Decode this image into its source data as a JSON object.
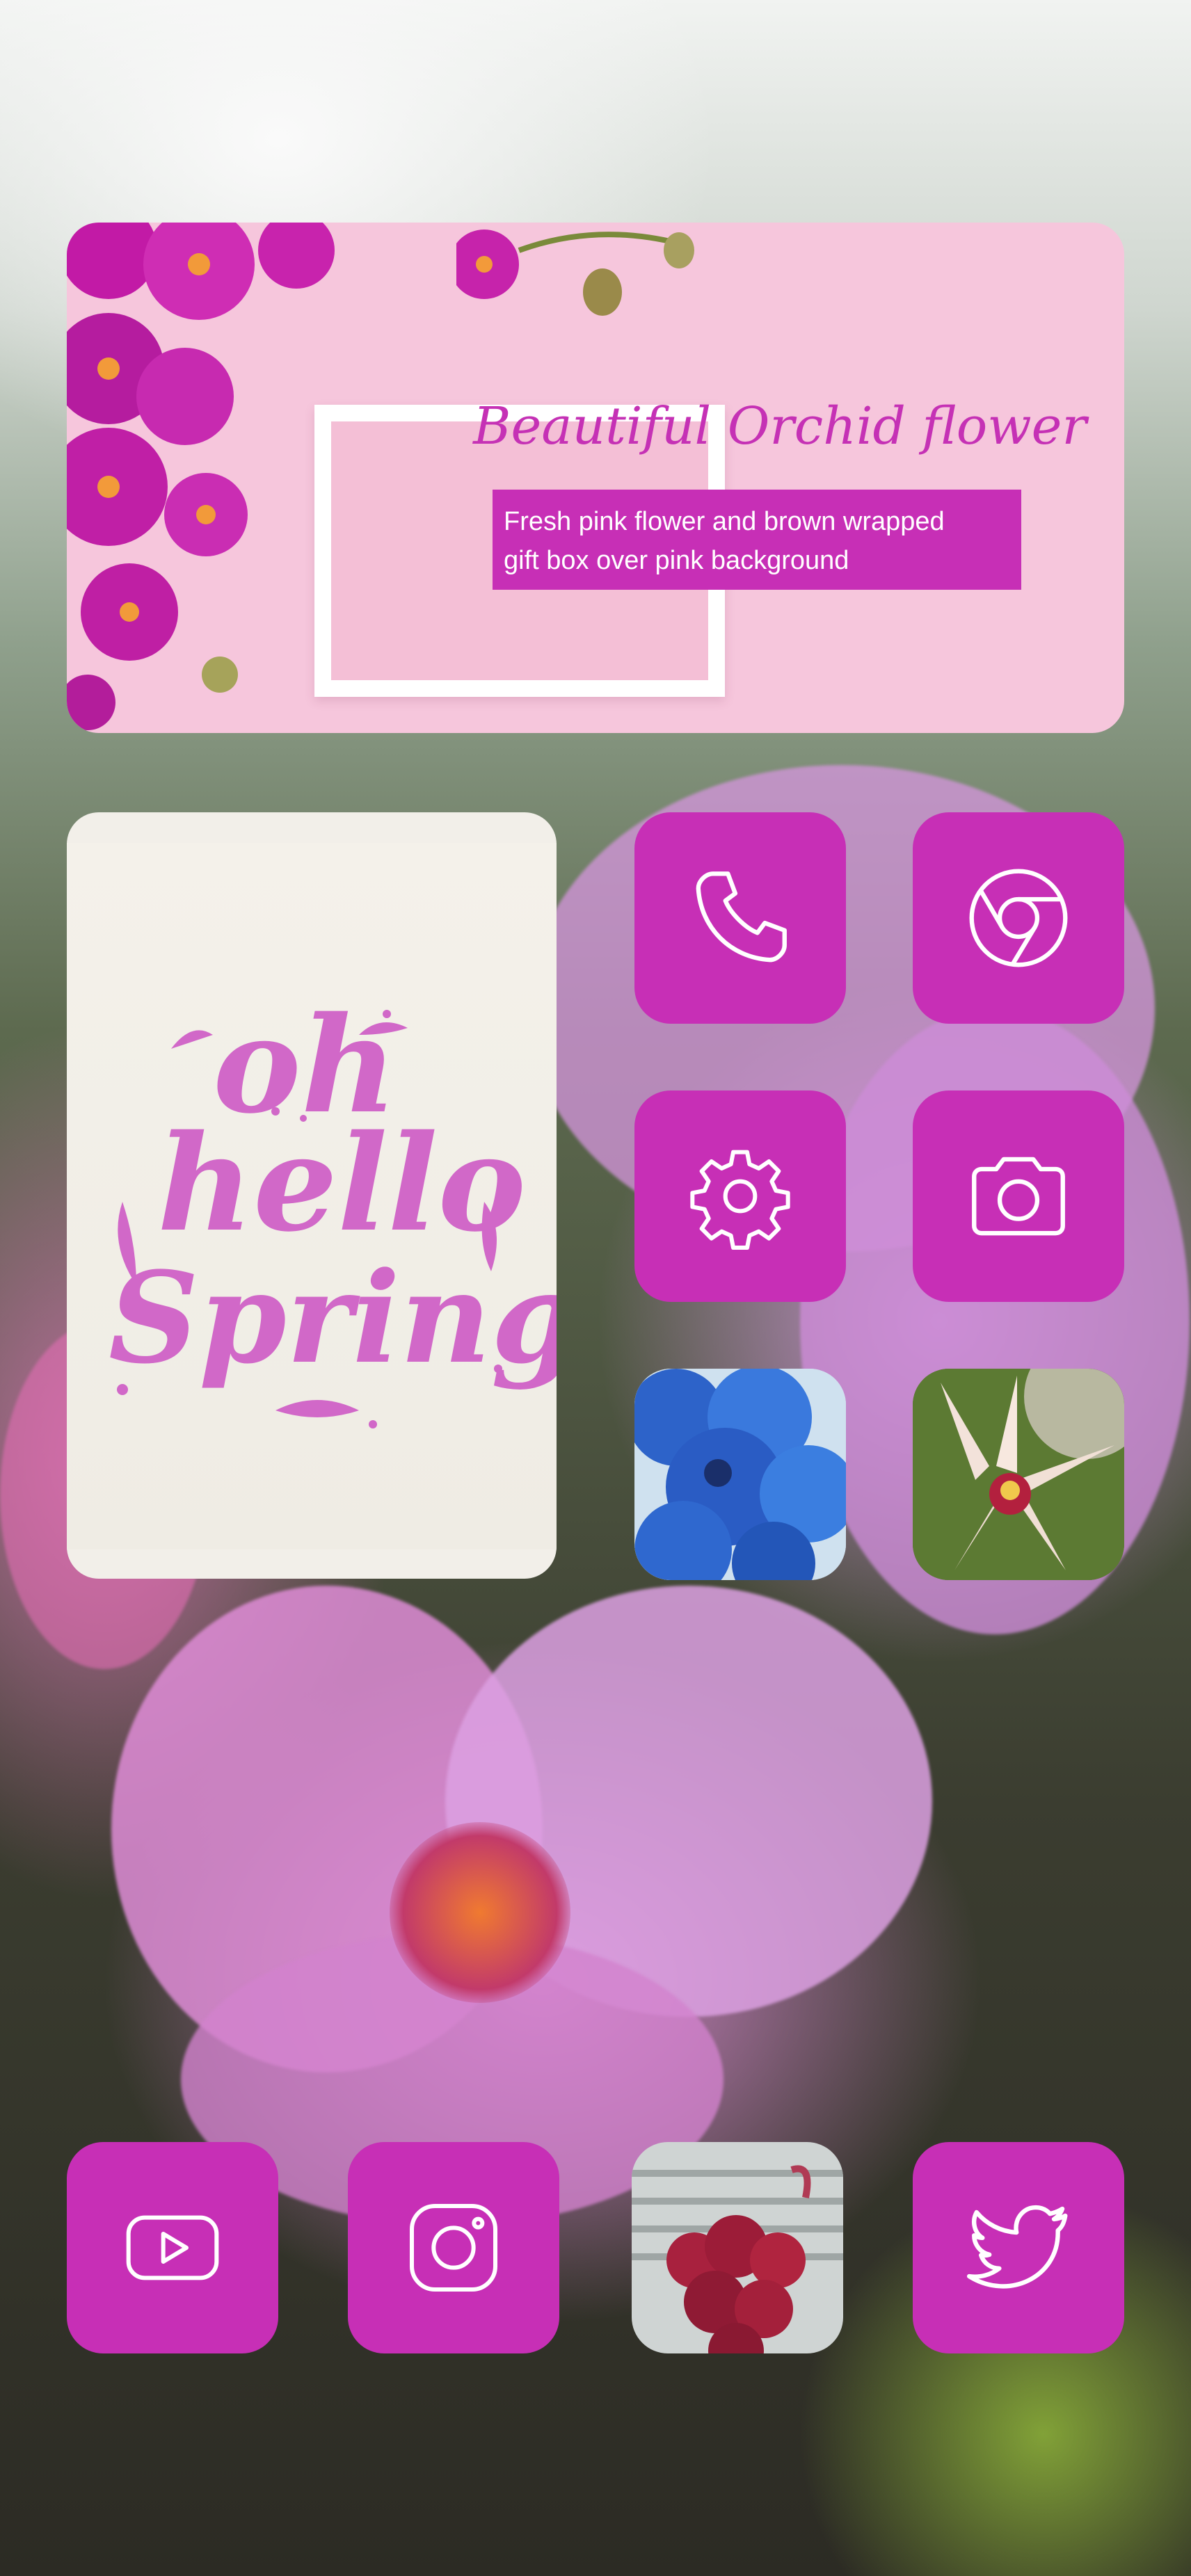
{
  "banner": {
    "title": "Beautiful Orchid flower",
    "description_line1": "Fresh pink flower and brown wrapped",
    "description_line2": "gift box over pink background"
  },
  "spring_widget": {
    "line1": "oh",
    "line2": "hello",
    "line3": "Spring"
  },
  "apps": {
    "phone": "phone-icon",
    "chrome": "chrome-icon",
    "settings": "gear-icon",
    "camera": "camera-icon",
    "youtube": "youtube-icon",
    "instagram": "instagram-icon",
    "twitter": "twitter-icon"
  },
  "colors": {
    "accent": "#c72fb6",
    "banner_bg": "#f6c6dc",
    "title_color": "#c531b5",
    "spring_lettering": "#d168c8"
  }
}
